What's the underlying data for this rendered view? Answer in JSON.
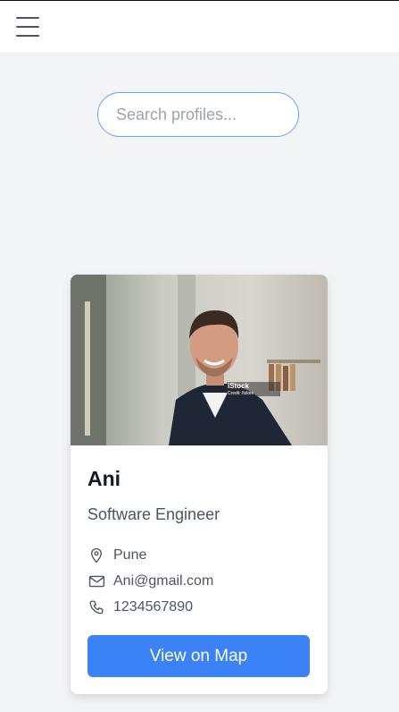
{
  "search": {
    "placeholder": "Search profiles..."
  },
  "profile": {
    "name": "Ani",
    "role": "Software Engineer",
    "location": "Pune",
    "email": "Ani@gmail.com",
    "phone": "1234567890",
    "photo_watermark": "iStock",
    "photo_credit": "Credit: fizkes",
    "map_button": "View on Map"
  },
  "colors": {
    "accent": "#3b82f6",
    "background": "#f3f4f6"
  }
}
